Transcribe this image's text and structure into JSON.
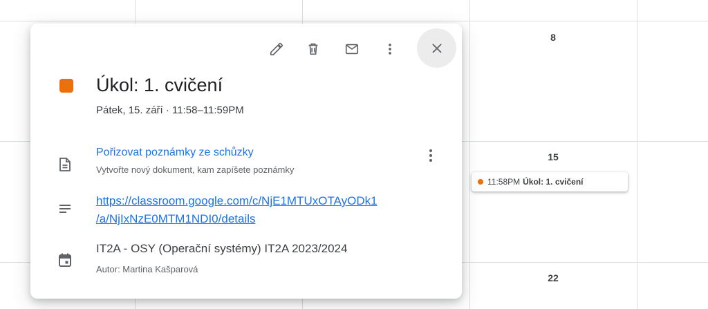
{
  "calendar": {
    "day_numbers": [
      "8",
      "15",
      "22"
    ],
    "event_chip": {
      "time": "11:58PM",
      "title": "Úkol: 1. cvičení",
      "color": "#e8710a"
    }
  },
  "popup": {
    "toolbar": {
      "edit_icon": "pencil-icon",
      "delete_icon": "trash-icon",
      "email_icon": "envelope-icon",
      "more_icon": "more-vert-icon",
      "close_icon": "close-icon"
    },
    "event_color": "#e8710a",
    "title": "Úkol: 1. cvičení",
    "datetime": "Pátek, 15. září  ·  11:58–11:59PM",
    "notes": {
      "icon": "document-icon",
      "label": "Pořizovat poznámky ze schůzky",
      "sublabel": "Vytvořte nový dokument, kam zapíšete poznámky"
    },
    "description": {
      "icon": "notes-lines-icon",
      "url_line1": "https://classroom.google.com/c/NjE1MTUxOTAyODk1",
      "url_line2": "/a/NjIxNzE0MTM1NDI0/details"
    },
    "calendar_info": {
      "icon": "calendar-icon",
      "name": "IT2A - OSY (Operační systémy) IT2A 2023/2024",
      "author": "Autor: Martina Kašparová"
    }
  }
}
